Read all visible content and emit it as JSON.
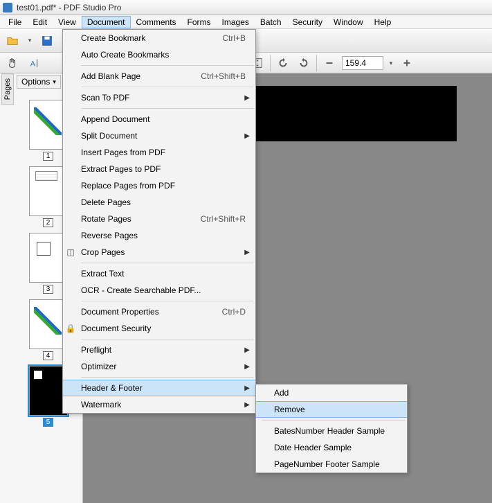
{
  "title": "test01.pdf* - PDF Studio Pro",
  "menubar": [
    "File",
    "Edit",
    "View",
    "Document",
    "Comments",
    "Forms",
    "Images",
    "Batch",
    "Security",
    "Window",
    "Help"
  ],
  "active_menu_index": 3,
  "zoom": "159.4",
  "sidebar": {
    "tab": "Pages",
    "options": "Options"
  },
  "thumbs": [
    {
      "num": "1",
      "sel": false
    },
    {
      "num": "2",
      "sel": false
    },
    {
      "num": "3",
      "sel": false
    },
    {
      "num": "4",
      "sel": false
    },
    {
      "num": "5",
      "sel": true
    }
  ],
  "doc_menu": {
    "groups": [
      [
        {
          "label": "Create Bookmark",
          "accel": "Ctrl+B"
        },
        {
          "label": "Auto Create Bookmarks"
        }
      ],
      [
        {
          "label": "Add Blank Page",
          "accel": "Ctrl+Shift+B"
        }
      ],
      [
        {
          "label": "Scan To PDF",
          "submenu": true
        }
      ],
      [
        {
          "label": "Append Document"
        },
        {
          "label": "Split Document",
          "submenu": true
        },
        {
          "label": "Insert Pages from PDF"
        },
        {
          "label": "Extract Pages to PDF"
        },
        {
          "label": "Replace Pages from PDF"
        },
        {
          "label": "Delete Pages"
        },
        {
          "label": "Rotate Pages",
          "accel": "Ctrl+Shift+R"
        },
        {
          "label": "Reverse Pages"
        },
        {
          "label": "Crop Pages",
          "submenu": true,
          "icon": "crop"
        }
      ],
      [
        {
          "label": "Extract Text"
        },
        {
          "label": "OCR - Create Searchable PDF..."
        }
      ],
      [
        {
          "label": "Document Properties",
          "accel": "Ctrl+D"
        },
        {
          "label": "Document Security",
          "icon": "lock"
        }
      ],
      [
        {
          "label": "Preflight",
          "submenu": true
        },
        {
          "label": "Optimizer",
          "submenu": true
        }
      ],
      [
        {
          "label": "Header & Footer",
          "submenu": true,
          "hover": true,
          "redbox": true
        },
        {
          "label": "Watermark",
          "submenu": true
        }
      ]
    ]
  },
  "submenu": {
    "items_top": [
      {
        "label": "Add"
      },
      {
        "label": "Remove",
        "hover": true,
        "redbox": true
      }
    ],
    "items_bottom": [
      {
        "label": "BatesNumber Header Sample"
      },
      {
        "label": "Date Header Sample"
      },
      {
        "label": "PageNumber Footer Sample"
      }
    ]
  }
}
